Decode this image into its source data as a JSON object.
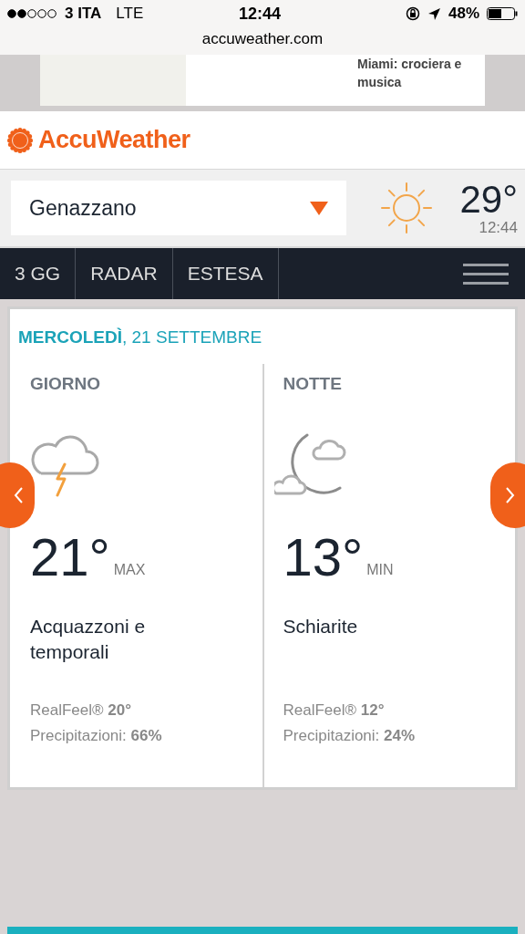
{
  "status_bar": {
    "carrier": "3 ITA",
    "network": "LTE",
    "time": "12:44",
    "battery": "48%"
  },
  "url_bar": {
    "address": "accuweather.com"
  },
  "ad": {
    "text": "Miami: crociera e musica"
  },
  "header": {
    "logo": "AccuWeather"
  },
  "location": {
    "value": "Genazzano",
    "temperature": "29°",
    "time": "12:44"
  },
  "nav": {
    "tabs": [
      {
        "label": "3 GG"
      },
      {
        "label": "RADAR"
      },
      {
        "label": "ESTESA"
      }
    ]
  },
  "forecast": {
    "date": "**MERCOLEDÌ**, 21 SETTEMBRE",
    "panels": [
      {
        "heading": "GIORNO",
        "kind": "storm",
        "temperature": "21°",
        "qualifier": "MAX",
        "condition": "Acquazzoni e temporali",
        "realfeel": "RealFeel® **20°**",
        "precipitation": "Precipitazioni: **66%**"
      },
      {
        "heading": "NOTTE",
        "kind": "night",
        "temperature": "13°",
        "qualifier": "MIN",
        "condition": "Schiarite",
        "realfeel": "RealFeel® **12°**",
        "precipitation": "Precipitazioni: **24%**"
      }
    ]
  }
}
